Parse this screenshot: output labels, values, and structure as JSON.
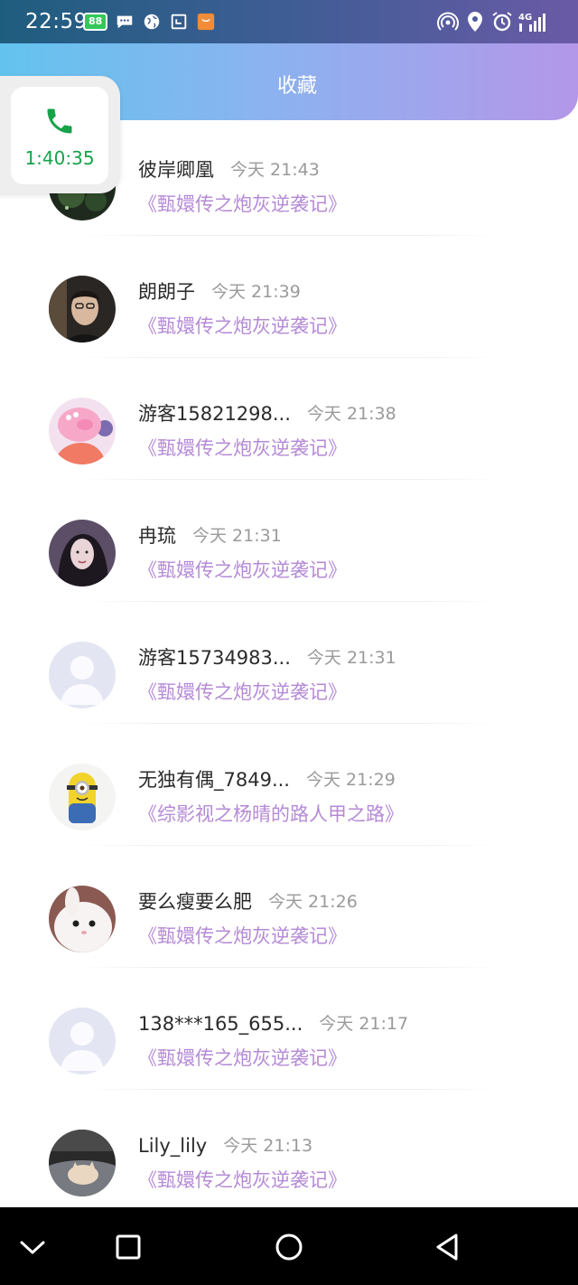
{
  "status_bar": {
    "time": "22:59",
    "battery": "88",
    "network": "4G"
  },
  "header": {
    "title": "收藏"
  },
  "call_widget": {
    "timer": "1:40:35"
  },
  "favorites": [
    {
      "user": "彼岸卿凰",
      "time": "今天 21:43",
      "book": "《甄嬛传之炮灰逆袭记》",
      "avatar": "avatar-dark-nature"
    },
    {
      "user": "朗朗子",
      "time": "今天 21:39",
      "book": "《甄嬛传之炮灰逆袭记》",
      "avatar": "avatar-man-portrait"
    },
    {
      "user": "游客15821298...",
      "time": "今天 21:38",
      "book": "《甄嬛传之炮灰逆袭记》",
      "avatar": "avatar-pink-pig"
    },
    {
      "user": "冉琉",
      "time": "今天 21:31",
      "book": "《甄嬛传之炮灰逆袭记》",
      "avatar": "avatar-woman-portrait"
    },
    {
      "user": "游客15734983...",
      "time": "今天 21:31",
      "book": "《甄嬛传之炮灰逆袭记》",
      "avatar": "avatar-default"
    },
    {
      "user": "无独有偶_7849...",
      "time": "今天 21:29",
      "book": "《综影视之杨晴的路人甲之路》",
      "avatar": "avatar-minion"
    },
    {
      "user": "要么瘦要么肥",
      "time": "今天 21:26",
      "book": "《甄嬛传之炮灰逆袭记》",
      "avatar": "avatar-white-rabbit"
    },
    {
      "user": "138***165_655...",
      "time": "今天 21:17",
      "book": "《甄嬛传之炮灰逆袭记》",
      "avatar": "avatar-default"
    },
    {
      "user": "Lily_lily",
      "time": "今天 21:13",
      "book": "《甄嬛传之炮灰逆袭记》",
      "avatar": "avatar-cat-photo"
    }
  ],
  "nav_bar": {
    "buttons": [
      "collapse",
      "recents",
      "home",
      "back"
    ]
  }
}
